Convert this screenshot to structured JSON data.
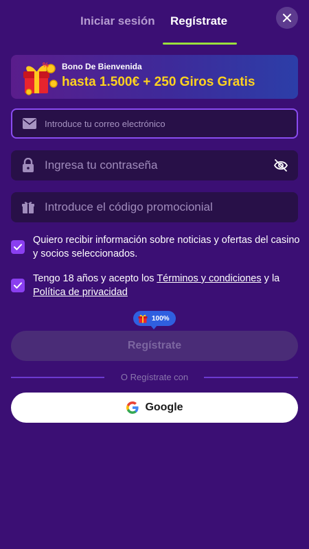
{
  "tabs": {
    "login": "Iniciar sesión",
    "register": "Regístrate"
  },
  "banner": {
    "small": "Bono De Bienvenida",
    "big": "hasta 1.500€ + 250 Giros Gratis"
  },
  "fields": {
    "email_placeholder": "Introduce tu correo electrónico",
    "password_placeholder": "Ingresa tu contraseña",
    "promo_placeholder": "Introduce el código promocionial"
  },
  "consent": {
    "marketing": "Quiero recibir información sobre noticias y ofertas del casino y socios seleccionados.",
    "age_prefix": "Tengo 18 años y acepto los ",
    "terms_link": "Términos y condiciones",
    "age_mid": " y la",
    "privacy_link": "Política de privacidad"
  },
  "bonus_pill": "100%",
  "submit_label": "Regístrate",
  "divider": "O Regístrate con",
  "google_label": "Google",
  "colors": {
    "background": "#3b0f74",
    "accent": "#9be03c",
    "checkbox": "#8a3ff0",
    "banner_text": "#ffd21f"
  },
  "icons": [
    "close-icon",
    "gift-icon",
    "mail-icon",
    "lock-icon",
    "eye-off-icon",
    "gift-icon",
    "check-icon",
    "google-icon"
  ]
}
